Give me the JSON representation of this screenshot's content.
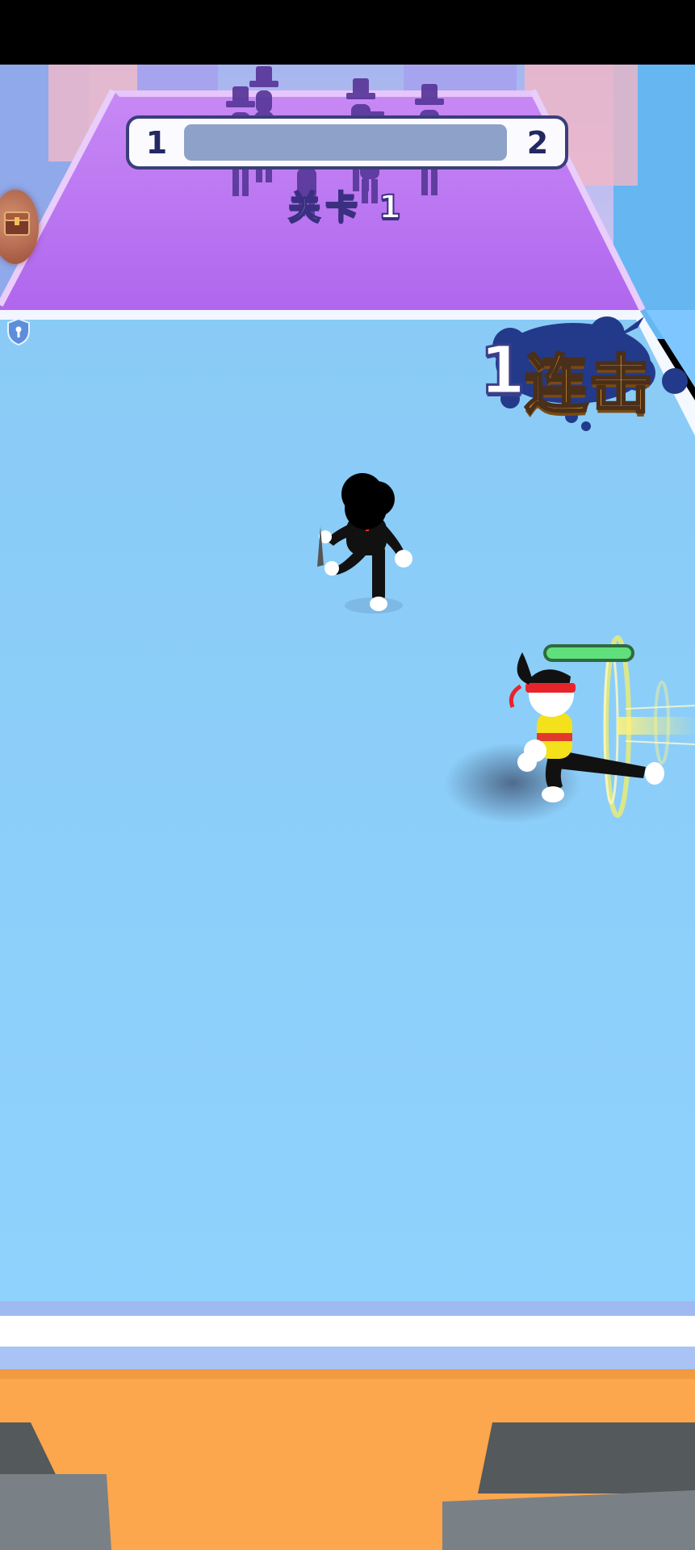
{
  "hud": {
    "level_start": "1",
    "level_end": "2",
    "level_label": "关卡 1",
    "progress_fraction": 0.0
  },
  "combo": {
    "count": "1",
    "label": "连击"
  },
  "icons": {
    "chest": "treasure-chest-icon",
    "shield": "shield-icon"
  },
  "player": {
    "health_fraction": 1.0
  },
  "colors": {
    "arena_floor": "#8ccff8",
    "back_platform": "#b56ef0",
    "front_ledge": "#fda54c",
    "health_bar": "#5fe07d",
    "progress_track": "#8ea1c9"
  }
}
